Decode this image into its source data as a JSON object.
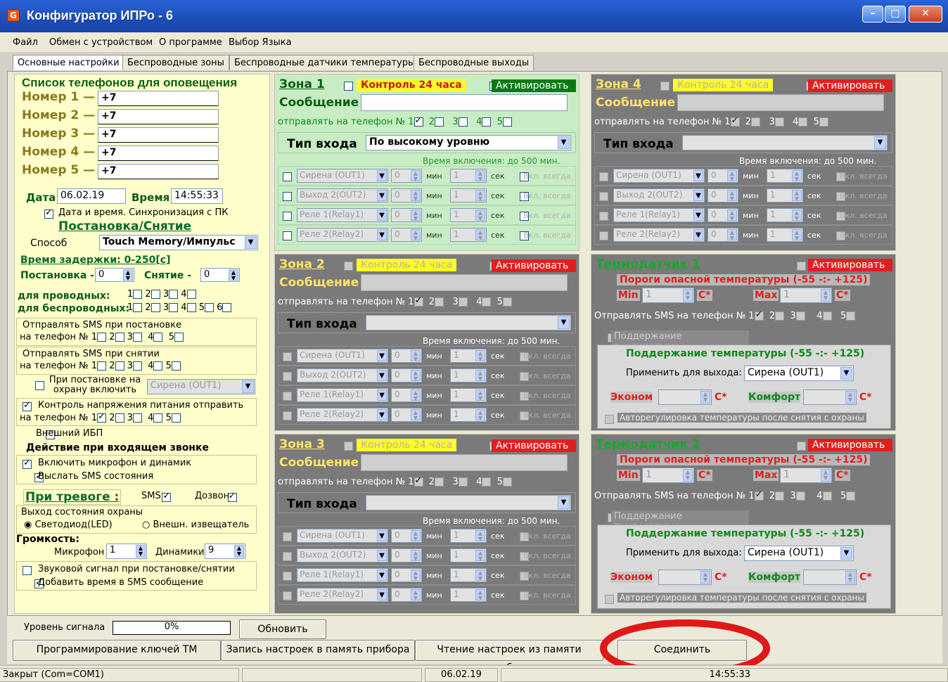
{
  "app": {
    "title": "Конфигуратор ИПРо - 6",
    "icon": "app-icon"
  },
  "menu": [
    "Файл",
    "Обмен с устройством",
    "О программе",
    "Выбор Языка"
  ],
  "tabs": [
    "Основные настройки",
    "Беспроводные зоны",
    "Беспроводные датчики температуры",
    "Беспроводные выходы"
  ],
  "left": {
    "phones_title": "Список телефонов для оповещения",
    "phones": [
      {
        "label": "Номер 1 —",
        "value": "+7"
      },
      {
        "label": "Номер 2 —",
        "value": "+7"
      },
      {
        "label": "Номер 3 —",
        "value": "+7"
      },
      {
        "label": "Номер 4 —",
        "value": "+7"
      },
      {
        "label": "Номер 5 —",
        "value": "+7"
      }
    ],
    "date_label": "Дата",
    "date_value": "06.02.19",
    "time_label": "Время",
    "time_value": "14:55:33",
    "sync_label": "Дата и время. Синхронизация с ПК",
    "arm_title": "Постановка/Снятие",
    "method_label": "Способ",
    "method_value": "Touch Memory/Импульс",
    "delay_title": "Время задержки: 0-250[c]",
    "arm_label": "Постановка -",
    "arm_value": "0",
    "disarm_label": "Снятие -",
    "disarm_value": "0",
    "wired_label": "для проводных:",
    "wireless_label": "для беспроводных:",
    "sms_arm": "Отправлять SMS при постановке",
    "sms_disarm": "Отправлять SMS при снятии",
    "on_phone": "на телефон №",
    "arm_enable_label": "При постановке на охрану включить",
    "arm_enable_value": "Сирена (OUT1)",
    "power_label": "Контроль напряжения питания отправить",
    "ext_ups": "Внешний ИБП",
    "call_title": "Действие при входящем звонке",
    "mic_enable": "Включить микрофон и динамик",
    "send_status": "Выслать SMS состояния",
    "alarm_title": "При тревоге :",
    "alarm_sms": "SMS",
    "alarm_call": "Дозвон",
    "out_state": "Выход состояния охраны",
    "led": "Светодиод(LED)",
    "ext_ind": "Внешн. извещатель",
    "volume": "Громкость:",
    "mic_label": "Микрофон",
    "mic_value": "1",
    "spk_label": "Динамики",
    "spk_value": "9",
    "sound_signal": "Звуковой сигнал при постановке/снятии",
    "add_time": "Добавить время в SMS сообщение"
  },
  "zone_common": {
    "ctrl24": "Контроль 24 часа",
    "activate": "Активировать",
    "message": "Сообщение",
    "send_to": "отправлять на телефон №",
    "input_type": "Тип входа",
    "on_time": "Время включения: до 500 мин.",
    "min": "мин",
    "sec": "сек",
    "always": "Вкл. всегда",
    "outs": [
      "Сирена (OUT1)",
      "Выход 2(OUT2)",
      "Реле 1(Relay1)",
      "Реле 2(Relay2)"
    ]
  },
  "zones": [
    {
      "title": "Зона 1",
      "input": "По высокому уровню"
    },
    {
      "title": "Зона 2",
      "input": ""
    },
    {
      "title": "Зона 3",
      "input": ""
    },
    {
      "title": "Зона 4",
      "input": ""
    }
  ],
  "thermo": {
    "t1": "Термодатчик 1",
    "t2": "Термодатчик 2",
    "activate": "Активировать",
    "thresholds": "Пороги опасной температуры (-55 -:- +125)",
    "min": "Min",
    "max": "Max",
    "unit": "C*",
    "send_sms": "Отправлять SMS на телефон №",
    "maintain": "Поддержание температуры",
    "maintain_title": "Поддержание температуры (-55 -:- +125)",
    "apply_out": "Применить для выхода:",
    "apply_value": "Сирена (OUT1)",
    "econom": "Эконом",
    "comfort": "Комфорт",
    "auto": "Авторегулировка температуры после снятия с охраны"
  },
  "bottom": {
    "signal_label": "Уровень сигнала",
    "signal_value": "0%",
    "refresh": "Обновить",
    "prog_keys": "Программирование ключей ТМ",
    "write": "Запись настроек в память прибора",
    "read": "Чтение настроек из памяти прибора",
    "connect": "Соединить"
  },
  "status": {
    "port": "Закрыт (Com=COM1)",
    "date": "06.02.19",
    "time": "14:55:33"
  },
  "colors": {
    "highlight": "#e01818",
    "title_bar": "#1d4fb9",
    "zone_active": "#c8ecc4",
    "zone_inactive": "#7a7a7a"
  }
}
